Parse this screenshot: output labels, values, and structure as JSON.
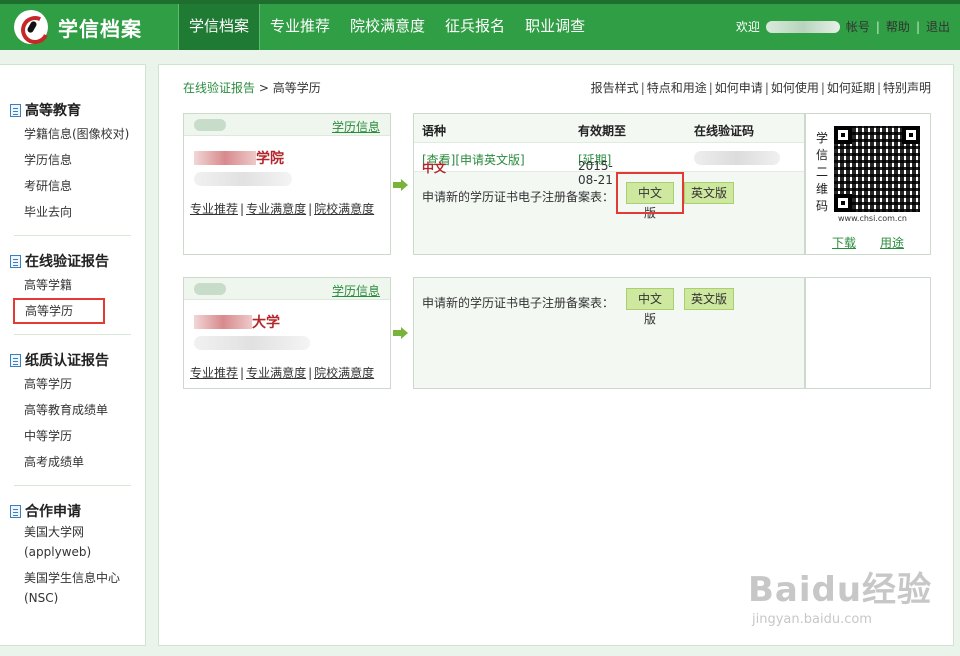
{
  "header": {
    "app_title": "学信档案",
    "nav": [
      "学信档案",
      "专业推荐",
      "院校满意度",
      "征兵报名",
      "职业调查"
    ],
    "welcome": "欢迎",
    "account_suffix": "帐号",
    "help": "帮助",
    "logout": "退出"
  },
  "sidebar": {
    "sections": [
      {
        "title": "高等教育",
        "items": [
          "学籍信息(图像校对)",
          "学历信息",
          "考研信息",
          "毕业去向"
        ]
      },
      {
        "title": "在线验证报告",
        "items": [
          "高等学籍",
          "高等学历"
        ]
      },
      {
        "title": "纸质认证报告",
        "items": [
          "高等学历",
          "高等教育成绩单",
          "中等学历",
          "高考成绩单"
        ]
      },
      {
        "title": "合作申请",
        "items": [
          "美国大学网\n(applyweb)",
          "美国学生信息中心\n(NSC)"
        ]
      }
    ],
    "selected_item": "高等学历"
  },
  "breadcrumb": {
    "root": "在线验证报告",
    "separator": ">",
    "current": "高等学历"
  },
  "top_links": [
    "报告样式",
    "特点和用途",
    "如何申请",
    "如何使用",
    "如何延期",
    "特别声明"
  ],
  "records": [
    {
      "card_label": "学历信息",
      "school_visible": "学院",
      "links": [
        "专业推荐",
        "专业满意度",
        "院校满意度"
      ],
      "table_headers": [
        "语种",
        "有效期至",
        "在线验证码"
      ],
      "row": {
        "language": "中文",
        "view": "[查看]",
        "apply_en": "[申请英文版]",
        "expiry": "2015-08-21",
        "extend": "[延期]"
      },
      "apply_text": "申请新的学历证书电子注册备案表：",
      "btn_cn": "中文版",
      "btn_en": "英文版"
    },
    {
      "card_label": "学历信息",
      "school_visible": "大学",
      "links": [
        "专业推荐",
        "专业满意度",
        "院校满意度"
      ],
      "apply_text": "申请新的学历证书电子注册备案表：",
      "btn_cn": "中文版",
      "btn_en": "英文版"
    }
  ],
  "qr": {
    "label": "学信二维码",
    "site": "www.chsi.com.cn",
    "download": "下载",
    "usage": "用途"
  },
  "watermark": {
    "brand": "Baidu经验",
    "url": "jingyan.baidu.com"
  },
  "colors": {
    "header_green": "#2f9e44",
    "accent_green": "#2b8c3e",
    "highlight_red": "#e53935",
    "button_green": "#cfe8a0"
  }
}
